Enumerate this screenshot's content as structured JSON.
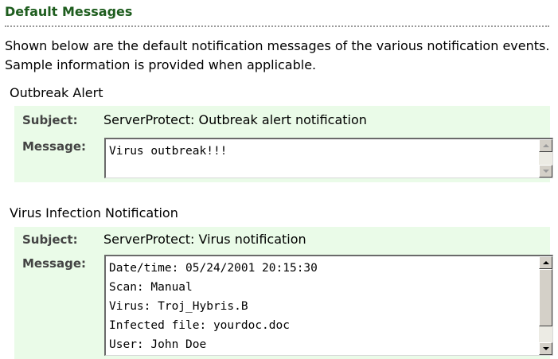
{
  "heading": "Default Messages",
  "intro": "Shown below are the default notification messages of the various notification events. Sample information is provided when applicable.",
  "labels": {
    "subject": "Subject:",
    "message": "Message:"
  },
  "sections": [
    {
      "title": "Outbreak Alert",
      "subject": "ServerProtect: Outbreak alert notification",
      "message": "Virus outbreak!!!"
    },
    {
      "title": "Virus Infection Notification",
      "subject": "ServerProtect: Virus notification",
      "message": "Date/time: 05/24/2001 20:15:30\nScan: Manual\nVirus: Troj_Hybris.B\nInfected file: yourdoc.doc\nUser: John Doe"
    }
  ],
  "colors": {
    "heading": "#1e5d1e",
    "panel_bg": "#eafbe8",
    "label": "#444444"
  },
  "icons": {
    "scroll_up": "scroll-up-arrow-icon",
    "scroll_down": "scroll-down-arrow-icon"
  }
}
